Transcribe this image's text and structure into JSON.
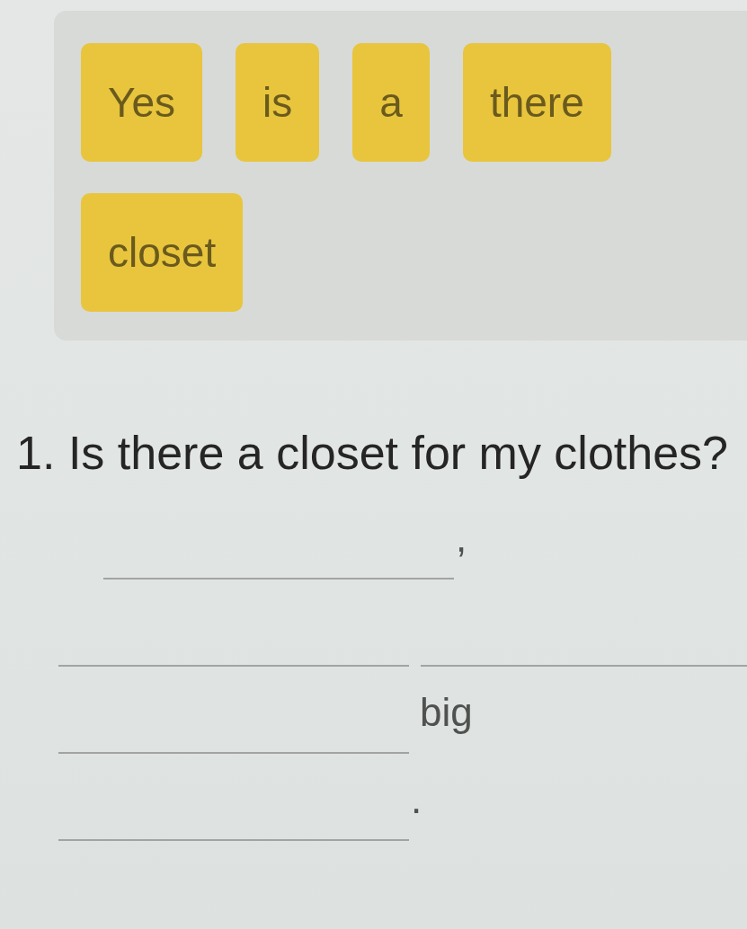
{
  "word_bank": {
    "tiles": [
      {
        "text": "Yes"
      },
      {
        "text": "is"
      },
      {
        "text": "a"
      },
      {
        "text": "there"
      },
      {
        "text": "closet"
      }
    ]
  },
  "question": {
    "number": "1.",
    "text": "Is there a closet for my clothes?"
  },
  "answer_rows": [
    {
      "items": [
        {
          "kind": "blank"
        },
        {
          "kind": "punctuation",
          "text": ","
        }
      ]
    },
    {
      "items": [
        {
          "kind": "blank"
        },
        {
          "kind": "blank"
        }
      ]
    },
    {
      "items": [
        {
          "kind": "blank"
        },
        {
          "kind": "word",
          "text": "big"
        }
      ]
    },
    {
      "items": [
        {
          "kind": "blank"
        },
        {
          "kind": "punctuation",
          "text": "."
        }
      ]
    }
  ]
}
